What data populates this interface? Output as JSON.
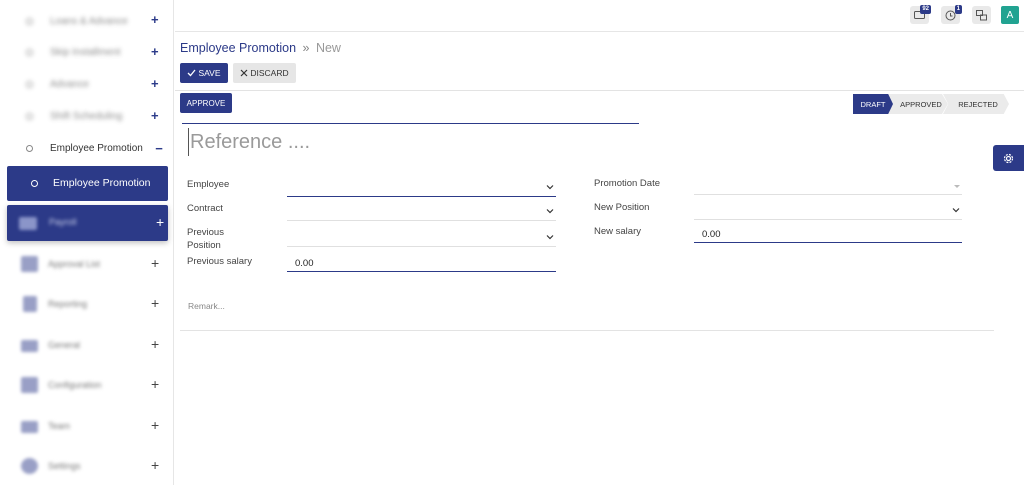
{
  "sidebar": {
    "items": [
      {
        "label": "Loans & Advance",
        "toggle": "+"
      },
      {
        "label": "Skip Installment",
        "toggle": "+"
      },
      {
        "label": "Advance",
        "toggle": "+"
      },
      {
        "label": "Shift Scheduling",
        "toggle": "+"
      },
      {
        "label": "Employee Promotion",
        "toggle": "−"
      }
    ],
    "active_sub": {
      "label": "Employee Promotion"
    },
    "payroll": {
      "label": "Payroll",
      "toggle": "+"
    },
    "modules": [
      {
        "label": "Approval List",
        "toggle": "+",
        "icon": "list-icon"
      },
      {
        "label": "Reporting",
        "toggle": "+",
        "icon": "document-icon"
      },
      {
        "label": "General",
        "toggle": "+",
        "icon": "mountain-icon"
      },
      {
        "label": "Configuration",
        "toggle": "+",
        "icon": "link-icon"
      },
      {
        "label": "Team",
        "toggle": "+",
        "icon": "team-icon"
      },
      {
        "label": "Settings",
        "toggle": "+",
        "icon": "settings-icon"
      }
    ]
  },
  "topbar": {
    "messages_count": "92",
    "activity_count": "1",
    "avatar_letter": "A"
  },
  "breadcrumb": {
    "parent": "Employee Promotion",
    "separator": "»",
    "current": "New"
  },
  "toolbar": {
    "save_label": "SAVE",
    "discard_label": "DISCARD",
    "approve_label": "APPROVE"
  },
  "status": {
    "draft": "DRAFT",
    "approved": "APPROVED",
    "rejected": "REJECTED",
    "active": "DRAFT"
  },
  "form": {
    "reference_placeholder": "Reference ....",
    "employee_label": "Employee",
    "contract_label": "Contract",
    "previous_position_label": "Previous Position",
    "previous_salary_label": "Previous salary",
    "previous_salary_value": "0.00",
    "promotion_date_label": "Promotion Date",
    "new_position_label": "New Position",
    "new_salary_label": "New salary",
    "new_salary_value": "0.00",
    "remark_placeholder": "Remark..."
  },
  "colors": {
    "primary": "#2c3a88",
    "avatar": "#21a391"
  }
}
